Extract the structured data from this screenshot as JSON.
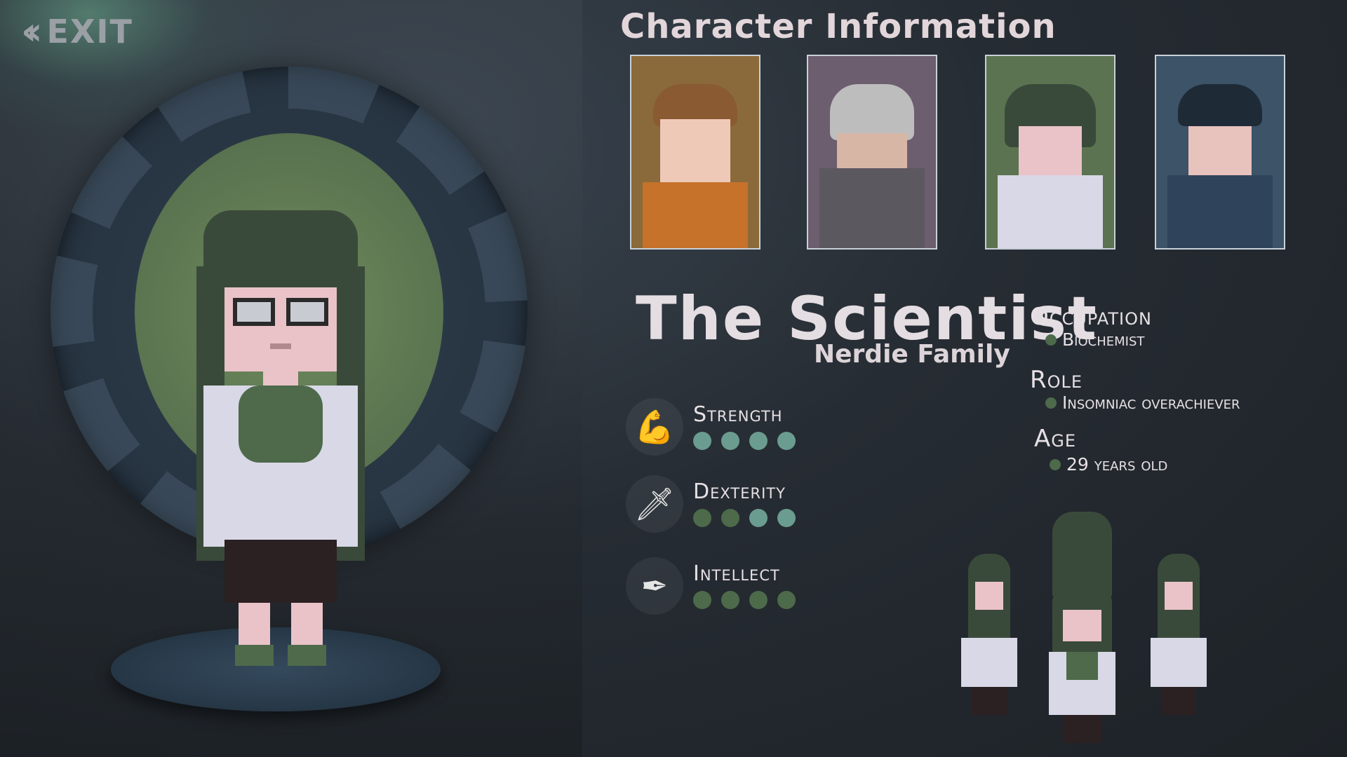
{
  "exit": {
    "label": "EXIT",
    "icon": "double-chevron-left-icon"
  },
  "panel": {
    "title": "Character Information"
  },
  "portraits": [
    {
      "name": "brown-haired-boy",
      "bg": "#8a6a3a"
    },
    {
      "name": "helmet-soldier",
      "bg": "#6c5e6e"
    },
    {
      "name": "scientist",
      "bg": "#5b7350"
    },
    {
      "name": "police-officer",
      "bg": "#3c5368"
    }
  ],
  "character": {
    "name": "The Scientist",
    "family": "Nerdie Family"
  },
  "stats": [
    {
      "label": "Strength",
      "icon": "flexed-arm-icon",
      "dots": [
        "#6b9c90",
        "#6b9c90",
        "#6b9c90",
        "#6b9c90"
      ]
    },
    {
      "label": "Dexterity",
      "icon": "dagger-icon",
      "dots": [
        "#4d6a4a",
        "#4d6a4a",
        "#6b9c90",
        "#6b9c90"
      ]
    },
    {
      "label": "Intellect",
      "icon": "quill-icon",
      "dots": [
        "#4d6a4a",
        "#4d6a4a",
        "#4d6a4a",
        "#4d6a4a"
      ]
    }
  ],
  "info": {
    "occupation_label": "Occupation",
    "occupation_value": "Biochemist",
    "role_label": "Role",
    "role_value": "Insomniac overachiever",
    "age_label": "Age",
    "age_value": "29 years old"
  },
  "colors": {
    "hair": "#3a4a3a",
    "skin": "#e9c3c8",
    "coat": "#d8d8e6",
    "shirt": "#4e6a4a",
    "skirt": "#2b2022",
    "accent_ring": "#6f8a5c"
  }
}
